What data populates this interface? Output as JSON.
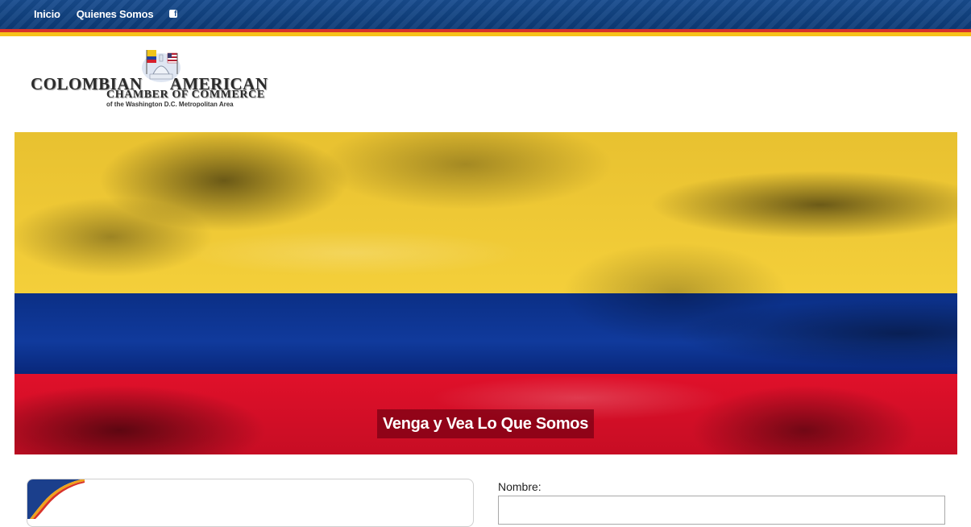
{
  "nav": {
    "items": [
      {
        "label": "Inicio"
      },
      {
        "label": "Quienes Somos"
      }
    ],
    "facebook_icon": "facebook-icon"
  },
  "logo": {
    "line1_left": "COLOMBIAN",
    "line1_right": "AMERICAN",
    "line2": "CHAMBER OF COMMERCE",
    "line3": "of the Washington D.C. Metropolitan Area"
  },
  "hero": {
    "caption": "Venga y Vea Lo Que Somos",
    "colors": {
      "yellow": "#f4cf3a",
      "blue": "#103a9c",
      "red": "#e0102a"
    }
  },
  "form": {
    "name_label": "Nombre:",
    "name_value": ""
  },
  "colors": {
    "topbar": "#0d3f7e",
    "stripe_red": "#d8322a",
    "stripe_yellow": "#f7c21a"
  }
}
